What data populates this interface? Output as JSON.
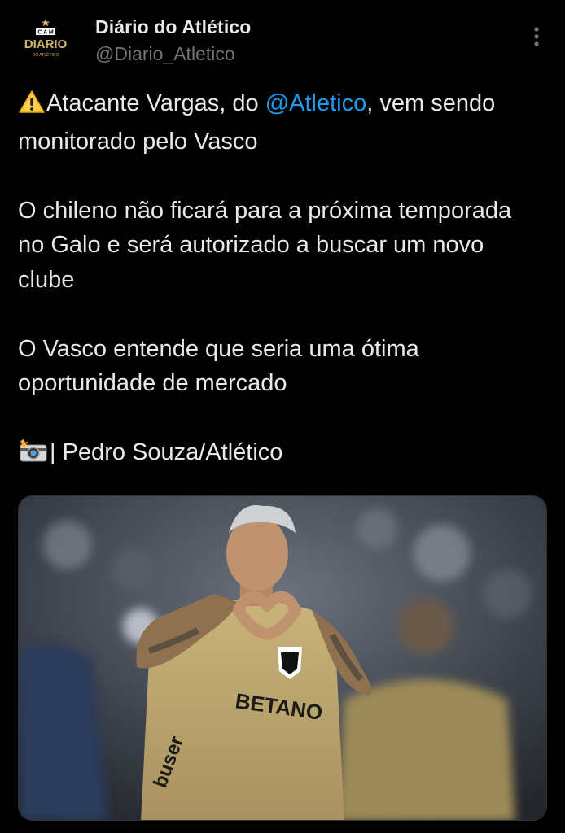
{
  "author": {
    "name": "Diário do Atlético",
    "handle": "@Diario_Atletico",
    "avatar_icon": "diario-atletico-logo"
  },
  "tweet": {
    "line1_before": "Atacante Vargas, do ",
    "mention": "@Atletico",
    "line1_after": ", vem sendo monitorado pelo Vasco",
    "paragraph2": "O chileno não ficará para a próxima temporada no Galo e será autorizado a buscar um novo clube",
    "paragraph3": "O Vasco entende que seria uma ótima oportunidade de mercado",
    "credit": "| Pedro Souza/Atlético",
    "warning_icon": "warning-icon",
    "camera_icon": "camera-flash-icon"
  },
  "media": {
    "description_icon": "player-heart-gesture-photo",
    "jersey_sponsor": "BETANO",
    "sleeve_sponsor": "buser"
  },
  "colors": {
    "background": "#000000",
    "text": "#e7e9ea",
    "secondary": "#71767b",
    "link": "#1d9bf0"
  }
}
